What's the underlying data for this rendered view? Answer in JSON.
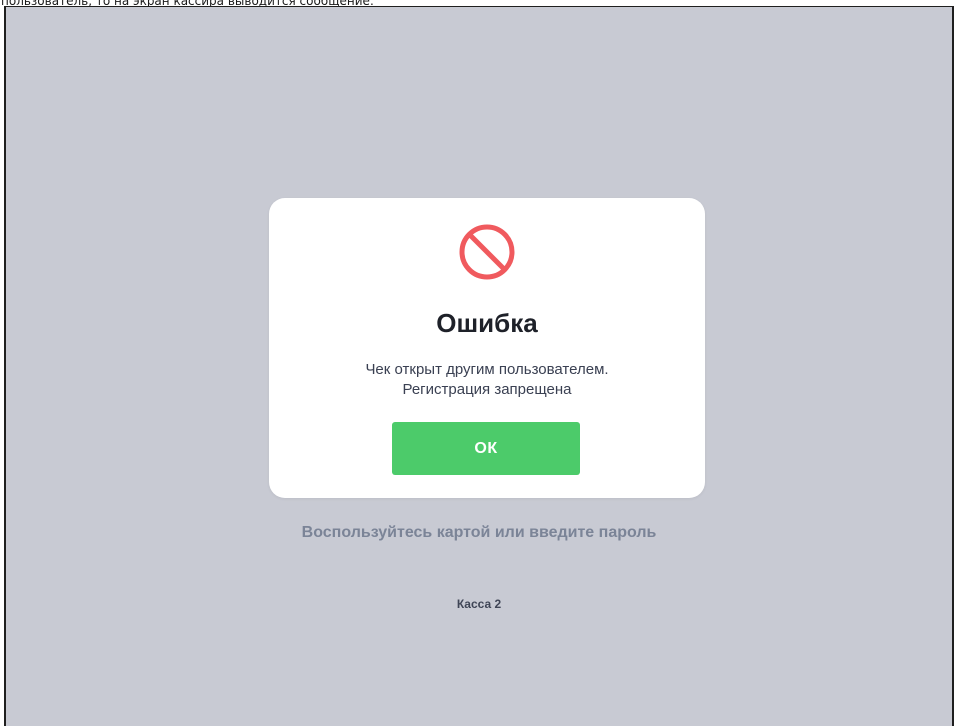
{
  "document": {
    "caption": "пользователь, то на экран кассира выводится сообщение:"
  },
  "dialog": {
    "icon": "prohibited-icon",
    "icon_color": "#f05a5e",
    "title": "Ошибка",
    "message_line1": "Чек открыт другим пользователем.",
    "message_line2": "Регистрация запрещена",
    "ok_label": "ОК",
    "ok_color": "#4ccb6a"
  },
  "screen": {
    "background": "#c8cad3",
    "hint": "Воспользуйтесь картой или введите пароль",
    "register_label": "Касса 2"
  }
}
